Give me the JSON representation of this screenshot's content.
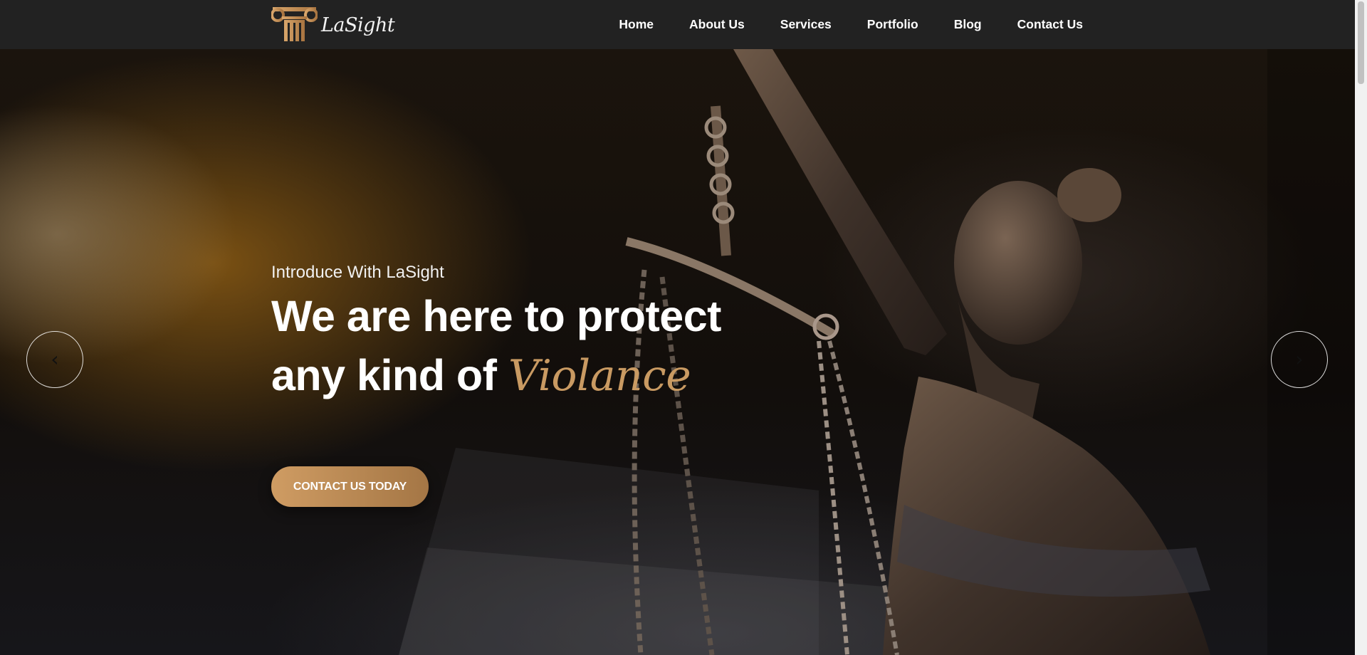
{
  "header": {
    "brand": "LaSight",
    "logo_icon": "ionic-column-icon",
    "nav": [
      {
        "label": "Home"
      },
      {
        "label": "About Us"
      },
      {
        "label": "Services"
      },
      {
        "label": "Portfolio"
      },
      {
        "label": "Blog"
      },
      {
        "label": "Contact Us"
      }
    ]
  },
  "hero": {
    "intro": "Introduce With LaSight",
    "title_line1": "We are here to protect",
    "title_line2_prefix": "any kind of ",
    "title_highlight": "Violance",
    "cta_label": "CONTACT US TODAY",
    "prev_icon": "chevron-left-icon",
    "next_icon": "chevron-right-icon",
    "prev_glyph": "‹",
    "next_glyph": "›"
  },
  "colors": {
    "accent": "#c99a62",
    "header_bg": "#222222",
    "text": "#ffffff"
  }
}
